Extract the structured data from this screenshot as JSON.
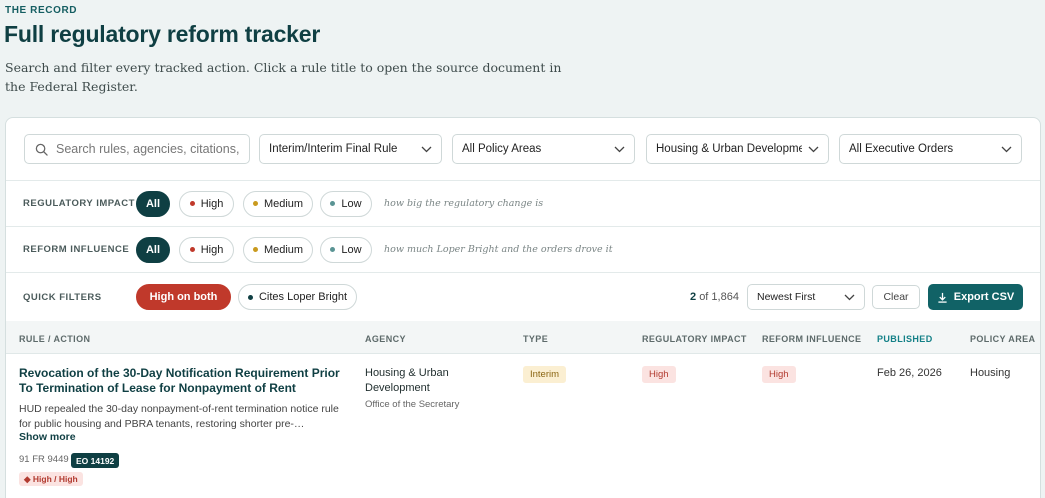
{
  "header": {
    "eyebrow": "THE RECORD",
    "title": "Full regulatory reform tracker",
    "intro": "Search and filter every tracked action. Click a rule title to open the source document in the Federal Register."
  },
  "filters": {
    "search_placeholder": "Search rules, agencies, citations, or keywords",
    "type_select": "Interim/Interim Final Rule",
    "policy_select": "All Policy Areas",
    "agency_select": "Housing & Urban Development",
    "eo_select": "All Executive Orders"
  },
  "impact_row": {
    "label": "REGULATORY IMPACT",
    "options": [
      "All",
      "High",
      "Medium",
      "Low"
    ],
    "hint": "how big the regulatory change is"
  },
  "influence_row": {
    "label": "REFORM INFLUENCE",
    "options": [
      "All",
      "High",
      "Medium",
      "Low"
    ],
    "hint": "how much Loper Bright and the orders drove it"
  },
  "quick_row": {
    "label": "QUICK FILTERS",
    "high_both": "High on both",
    "loper": "Cites Loper Bright",
    "count_shown": "2",
    "count_total": "of 1,864",
    "sort": "Newest First",
    "clear": "Clear",
    "export": "Export CSV"
  },
  "table": {
    "headers": [
      "RULE / ACTION",
      "AGENCY",
      "TYPE",
      "REGULATORY IMPACT",
      "REFORM INFLUENCE",
      "PUBLISHED",
      "POLICY AREA"
    ],
    "rows": [
      {
        "title": "Revocation of the 30-Day Notification Requirement Prior To Termination of Lease for Nonpayment of Rent",
        "description": "HUD repealed the 30-day nonpayment-of-rent termination notice rule for public housing and PBRA tenants, restoring shorter pre-…",
        "show_more": "Show more",
        "citation": "91 FR 9449",
        "eo": "EO 14192",
        "impact_tag": "◆ High / High",
        "agency": "Housing & Urban Development",
        "office": "Office of the Secretary",
        "type": "Interim",
        "impact": "High",
        "influence": "High",
        "published": "Feb 26, 2026",
        "area": "Housing"
      }
    ]
  },
  "colors": {
    "brand": "#0f3f43",
    "accent": "#116266",
    "high": "#c0392b",
    "medium": "#c99a1e",
    "low": "#5a9494"
  }
}
